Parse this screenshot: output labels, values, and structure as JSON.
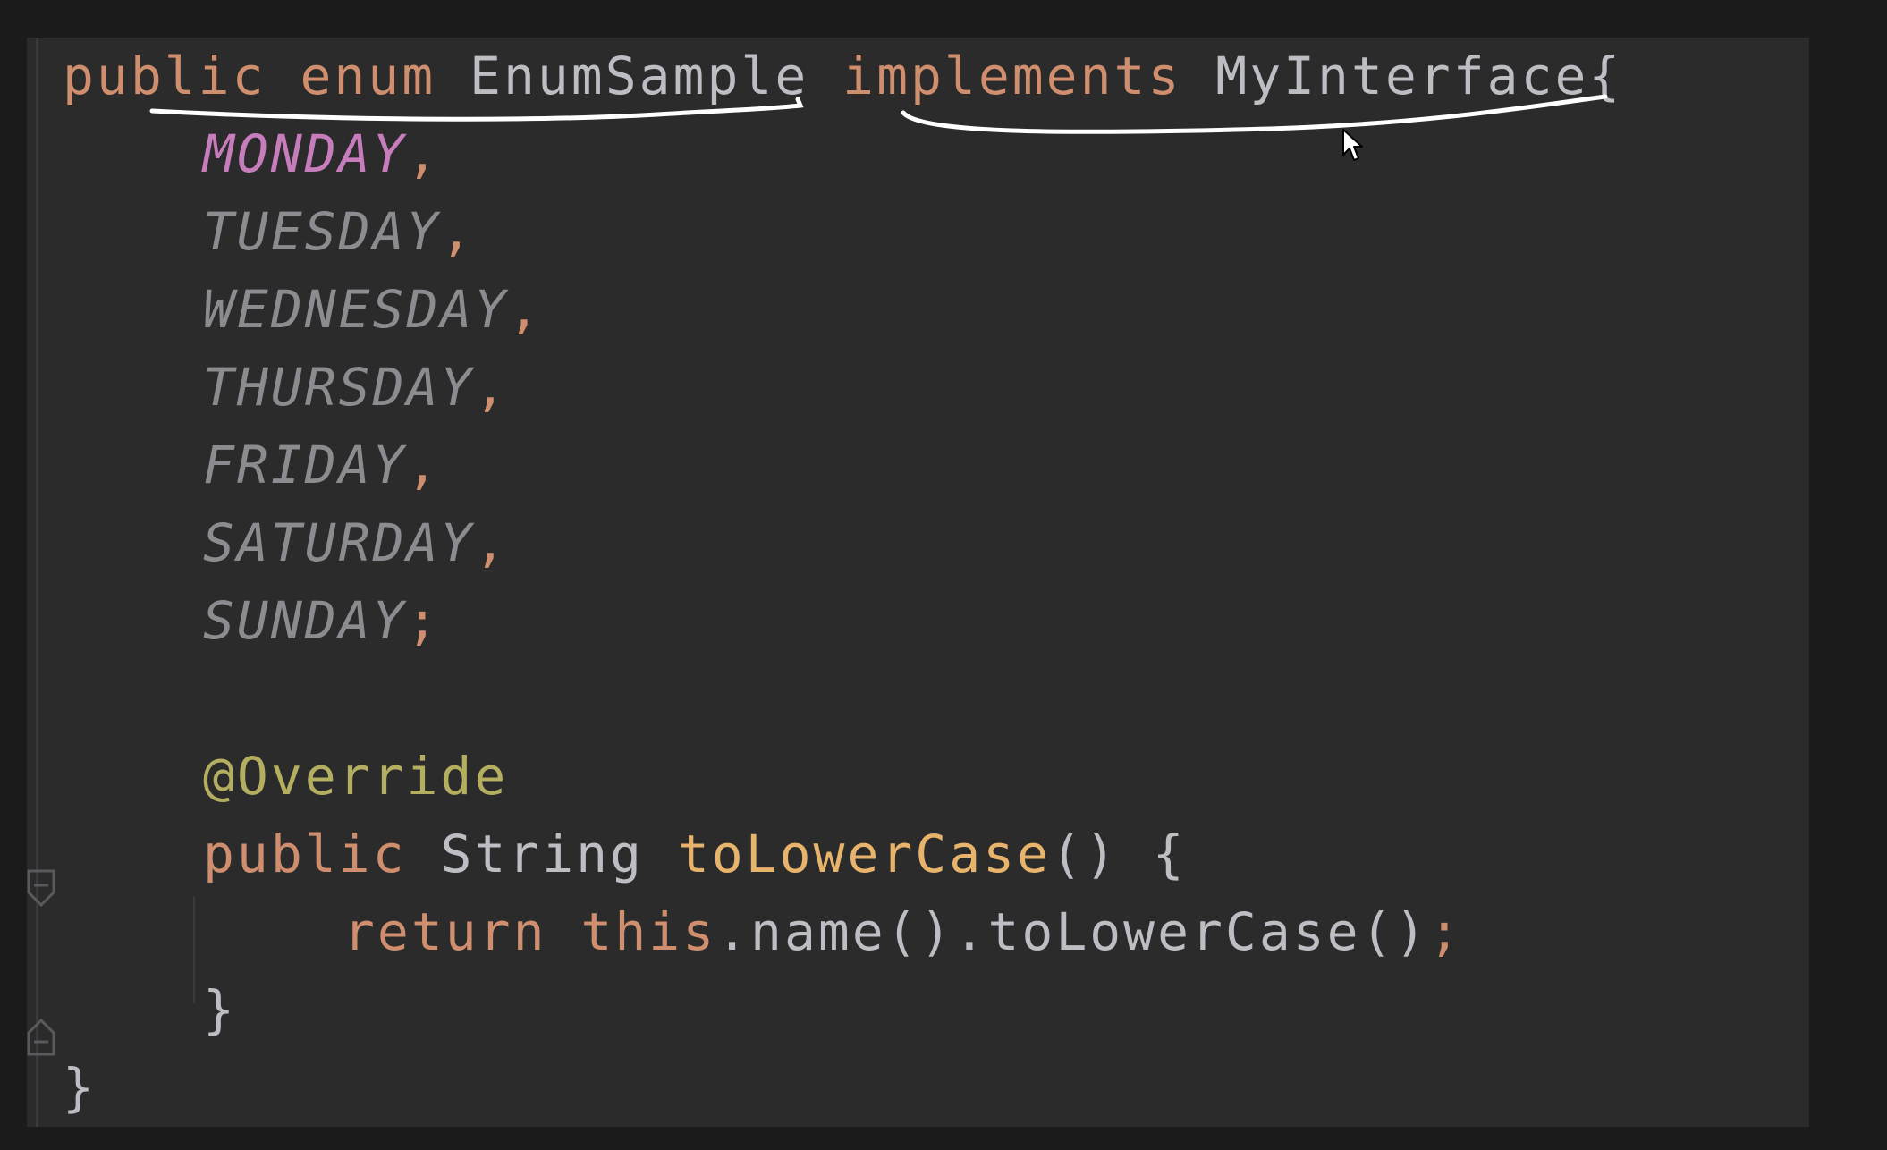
{
  "code": {
    "line1": {
      "kw_public": "public",
      "kw_enum": "enum",
      "class_name": "EnumSample",
      "kw_implements": "implements",
      "interface_name": "MyInterface",
      "brace_open": "{"
    },
    "enum_constants": [
      {
        "name": "MONDAY",
        "sep": ","
      },
      {
        "name": "TUESDAY",
        "sep": ","
      },
      {
        "name": "WEDNESDAY",
        "sep": ","
      },
      {
        "name": "THURSDAY",
        "sep": ","
      },
      {
        "name": "FRIDAY",
        "sep": ","
      },
      {
        "name": "SATURDAY",
        "sep": ","
      },
      {
        "name": "SUNDAY",
        "sep": ";"
      }
    ],
    "annotation": "@Override",
    "method": {
      "kw_public": "public",
      "return_type": "String",
      "name": "toLowerCase",
      "params": "()",
      "brace_open": "{"
    },
    "body": {
      "kw_return": "return",
      "kw_this": "this",
      "rest": ".name().toLowerCase()",
      "semicolon": ";"
    },
    "method_close": "}",
    "class_close": "}"
  },
  "colors": {
    "keyword": "#cf8e6d",
    "enum_constant_active": "#c77dbb",
    "annotation": "#b3ae60",
    "method_name": "#e8b36b",
    "text": "#bcbec4",
    "background": "#2b2b2c"
  },
  "icons": {
    "cursor": "mouse-pointer-icon",
    "fold_start": "fold-start-icon",
    "fold_end": "fold-end-icon"
  }
}
